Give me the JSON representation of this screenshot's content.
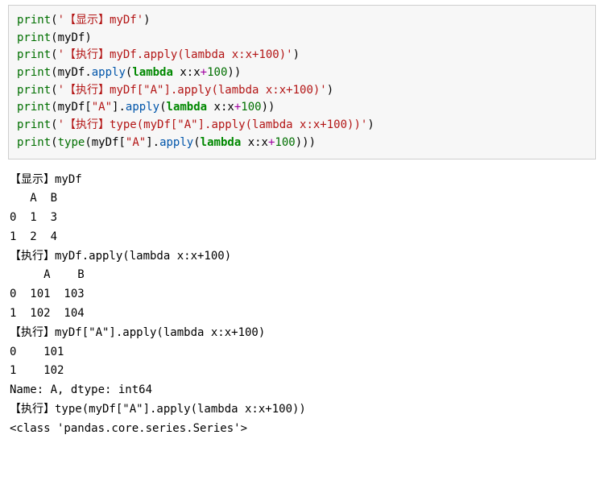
{
  "code": {
    "l1": {
      "fn": "print",
      "open": "(",
      "str": "'【显示】myDf'",
      "close": ")"
    },
    "l2": {
      "fn": "print",
      "open": "(",
      "id": "myDf",
      "close": ")"
    },
    "l3": {
      "fn": "print",
      "open": "(",
      "str": "'【执行】myDf.apply(lambda x:x+100)'",
      "close": ")"
    },
    "l4": {
      "fn": "print",
      "open": "(",
      "id": "myDf",
      "dot": ".",
      "attr": "apply",
      "aopen": "(",
      "kw": "lambda",
      "sp": " ",
      "x1": "x:x",
      "op": "+",
      "num": "100",
      "aclose": "))"
    },
    "l5": {
      "fn": "print",
      "open": "(",
      "str": "'【执行】myDf[\"A\"].apply(lambda x:x+100)'",
      "close": ")"
    },
    "l6": {
      "fn": "print",
      "open": "(",
      "id": "myDf[",
      "s": "\"A\"",
      "id2": "]",
      "dot": ".",
      "attr": "apply",
      "aopen": "(",
      "kw": "lambda",
      "sp": " ",
      "x1": "x:x",
      "op": "+",
      "num": "100",
      "aclose": "))"
    },
    "l7": {
      "fn": "print",
      "open": "(",
      "str": "'【执行】type(myDf[\"A\"].apply(lambda x:x+100))'",
      "close": ")"
    },
    "l8": {
      "fn": "print",
      "open": "(",
      "fn2": "type",
      "topen": "(",
      "id": "myDf[",
      "s": "\"A\"",
      "id2": "]",
      "dot": ".",
      "attr": "apply",
      "aopen": "(",
      "kw": "lambda",
      "sp": " ",
      "x1": "x:x",
      "op": "+",
      "num": "100",
      "aclose": ")))"
    }
  },
  "output": "【显示】myDf\n   A  B\n0  1  3\n1  2  4\n【执行】myDf.apply(lambda x:x+100)\n     A    B\n0  101  103\n1  102  104\n【执行】myDf[\"A\"].apply(lambda x:x+100)\n0    101\n1    102\nName: A, dtype: int64\n【执行】type(myDf[\"A\"].apply(lambda x:x+100))\n<class 'pandas.core.series.Series'>"
}
